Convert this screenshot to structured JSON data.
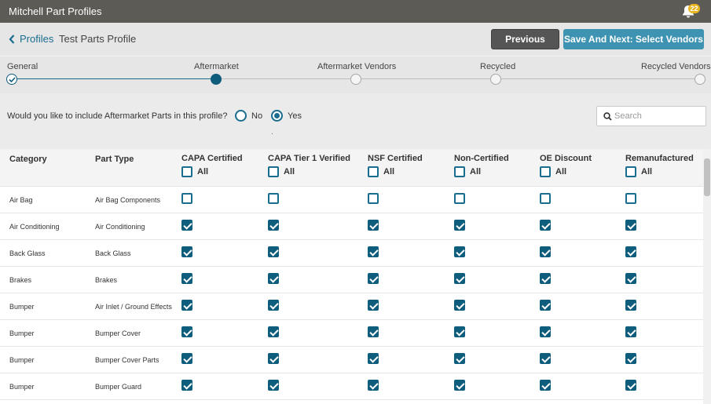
{
  "app": {
    "title": "Mitchell Part Profiles",
    "notification_count": "22"
  },
  "header": {
    "back_label": "Profiles",
    "profile_name": "Test Parts Profile",
    "previous_label": "Previous",
    "next_label": "Save And Next: Select Vendors"
  },
  "steps": [
    {
      "label": "General",
      "state": "done"
    },
    {
      "label": "Aftermarket",
      "state": "active"
    },
    {
      "label": "Aftermarket Vendors",
      "state": "pending"
    },
    {
      "label": "Recycled",
      "state": "pending"
    },
    {
      "label": "Recycled Vendors",
      "state": "pending"
    }
  ],
  "question": {
    "text": "Would you like to include Aftermarket Parts in this profile?",
    "no_label": "No",
    "yes_label": "Yes",
    "selected": "Yes"
  },
  "search": {
    "placeholder": "Search"
  },
  "table": {
    "headers": {
      "category": "Category",
      "part_type": "Part Type",
      "all_label": "All"
    },
    "columns": [
      "CAPA Certified",
      "CAPA Tier 1 Verified",
      "NSF Certified",
      "Non-Certified",
      "OE Discount",
      "Remanufactured"
    ],
    "rows": [
      {
        "category": "Air Bag",
        "part_type": "Air Bag Components",
        "checked": [
          false,
          false,
          false,
          false,
          false,
          false
        ]
      },
      {
        "category": "Air Conditioning",
        "part_type": "Air Conditioning",
        "checked": [
          true,
          true,
          true,
          true,
          true,
          true
        ]
      },
      {
        "category": "Back Glass",
        "part_type": "Back Glass",
        "checked": [
          true,
          true,
          true,
          true,
          true,
          true
        ]
      },
      {
        "category": "Brakes",
        "part_type": "Brakes",
        "checked": [
          true,
          true,
          true,
          true,
          true,
          true
        ]
      },
      {
        "category": "Bumper",
        "part_type": "Air Inlet / Ground Effects",
        "checked": [
          true,
          true,
          true,
          true,
          true,
          true
        ]
      },
      {
        "category": "Bumper",
        "part_type": "Bumper Cover",
        "checked": [
          true,
          true,
          true,
          true,
          true,
          true
        ]
      },
      {
        "category": "Bumper",
        "part_type": "Bumper Cover Parts",
        "checked": [
          true,
          true,
          true,
          true,
          true,
          true
        ]
      },
      {
        "category": "Bumper",
        "part_type": "Bumper Guard",
        "checked": [
          true,
          true,
          true,
          true,
          true,
          true
        ]
      }
    ]
  },
  "colors": {
    "titlebar": "#5d5b56",
    "accent": "#1a6d8f",
    "primary_button": "#3d93b1",
    "checkbox_fill": "#0f5d7c",
    "badge": "#e8b51c"
  }
}
